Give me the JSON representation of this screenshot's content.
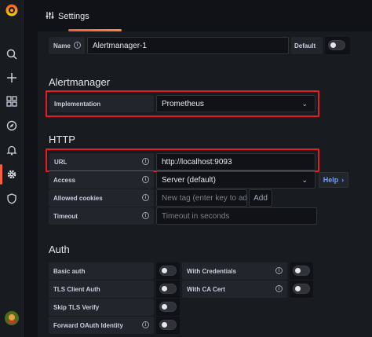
{
  "nav": {
    "items": [
      {
        "name": "search-icon"
      },
      {
        "name": "plus-icon"
      },
      {
        "name": "dashboards-icon"
      },
      {
        "name": "explore-compass-icon"
      },
      {
        "name": "alerting-bell-icon"
      },
      {
        "name": "configuration-gear-icon",
        "active": true
      },
      {
        "name": "server-admin-shield-icon"
      }
    ]
  },
  "tab": {
    "label": "Settings",
    "icon": "sliders-icon"
  },
  "general": {
    "name_label": "Name",
    "name_value": "Alertmanager-1",
    "default_label": "Default"
  },
  "alertmanager": {
    "title": "Alertmanager",
    "implementation_label": "Implementation",
    "implementation_value": "Prometheus"
  },
  "http": {
    "title": "HTTP",
    "url_label": "URL",
    "url_value": "http://localhost:9093",
    "access_label": "Access",
    "access_value": "Server (default)",
    "help_label": "Help",
    "allowed_cookies_label": "Allowed cookies",
    "allowed_cookies_placeholder": "New tag (enter key to add)",
    "add_label": "Add",
    "timeout_label": "Timeout",
    "timeout_placeholder": "Timeout in seconds"
  },
  "auth": {
    "title": "Auth",
    "basic_auth_label": "Basic auth",
    "with_credentials_label": "With Credentials",
    "tls_client_auth_label": "TLS Client Auth",
    "with_ca_cert_label": "With CA Cert",
    "skip_tls_verify_label": "Skip TLS Verify",
    "forward_oauth_label": "Forward OAuth Identity"
  },
  "colors": {
    "accent": "#f55f3e",
    "highlight": "#e31d24",
    "link": "#6e9fff"
  }
}
